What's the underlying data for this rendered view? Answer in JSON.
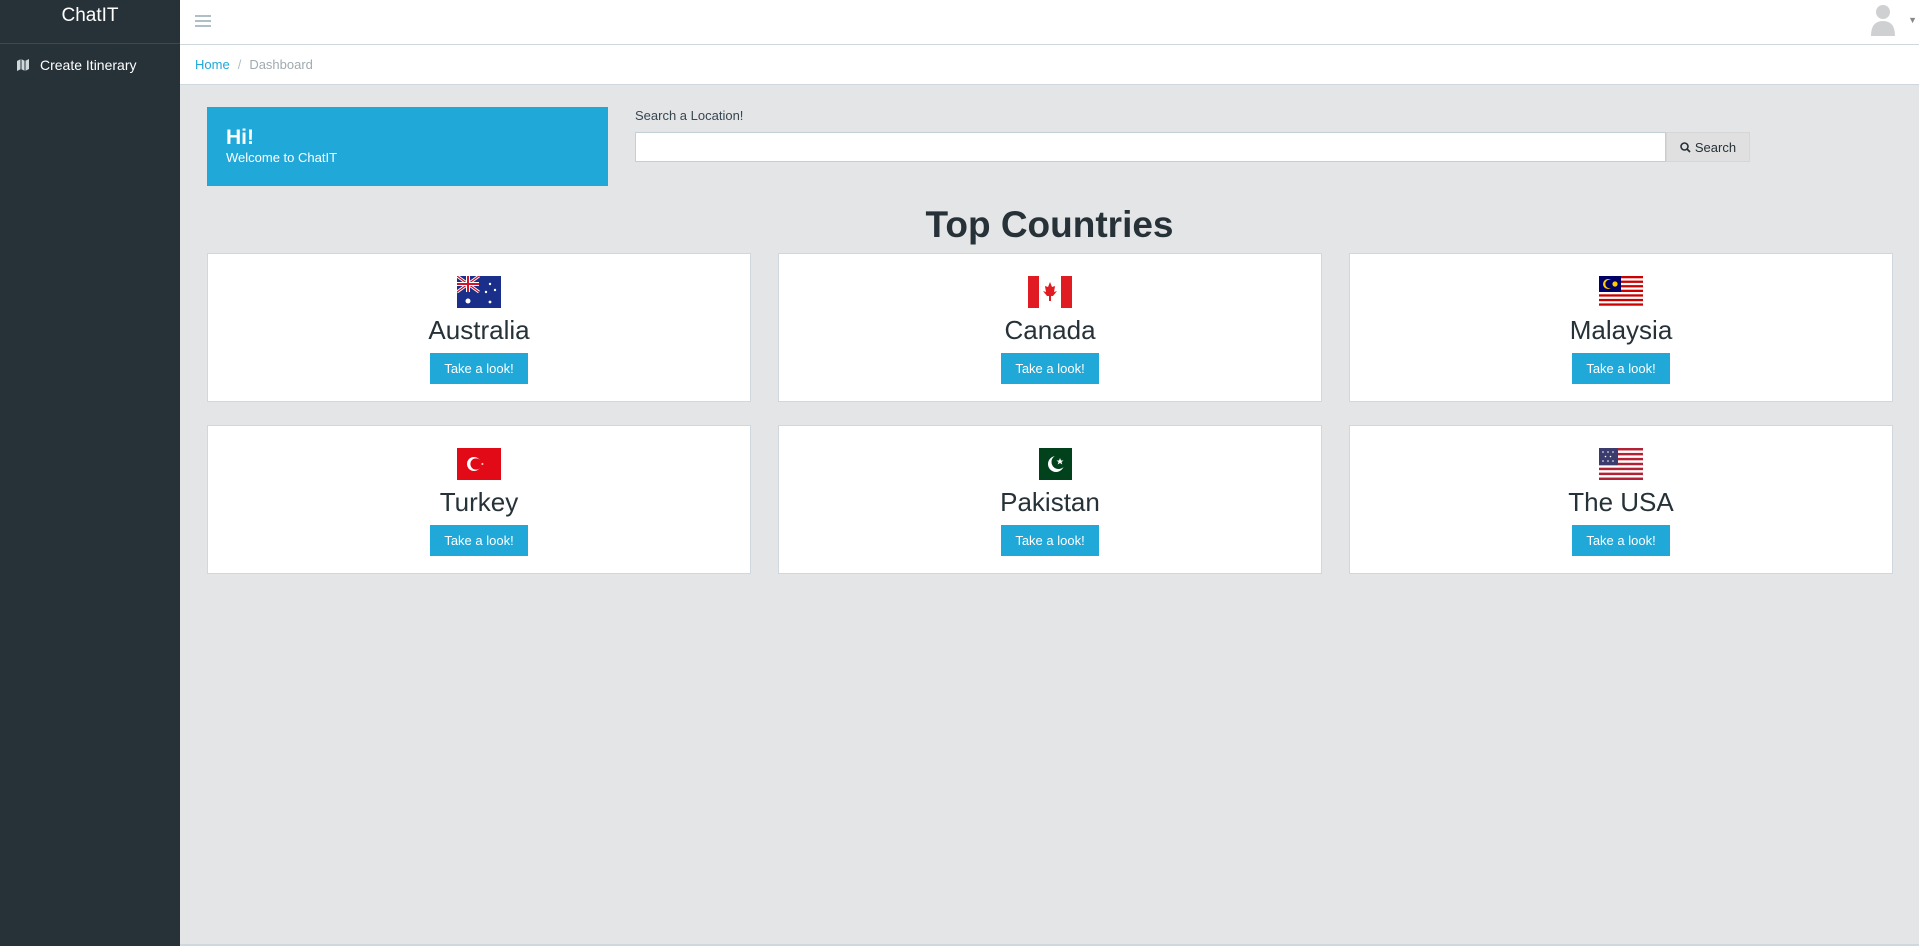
{
  "sidebar": {
    "brand": "ChatIT",
    "items": [
      {
        "label": "Create Itinerary",
        "icon": "map-icon"
      }
    ]
  },
  "topbar": {
    "menu_icon": "hamburger-icon",
    "avatar_icon": "user-avatar-icon"
  },
  "breadcrumb": {
    "home": "Home",
    "separator": "/",
    "current": "Dashboard"
  },
  "welcome": {
    "greeting": "Hi!",
    "message": "Welcome to ChatIT"
  },
  "search": {
    "label": "Search a Location!",
    "value": "",
    "placeholder": "",
    "button_label": "Search"
  },
  "section_title": "Top Countries",
  "countries": [
    {
      "name": "Australia",
      "flag": "australia-flag",
      "button": "Take a look!"
    },
    {
      "name": "Canada",
      "flag": "canada-flag",
      "button": "Take a look!"
    },
    {
      "name": "Malaysia",
      "flag": "malaysia-flag",
      "button": "Take a look!"
    },
    {
      "name": "Turkey",
      "flag": "turkey-flag",
      "button": "Take a look!"
    },
    {
      "name": "Pakistan",
      "flag": "pakistan-flag",
      "button": "Take a look!"
    },
    {
      "name": "The USA",
      "flag": "usa-flag",
      "button": "Take a look!"
    }
  ],
  "colors": {
    "accent": "#20a8d8",
    "sidebar": "#263238",
    "background": "#e4e5e6"
  }
}
